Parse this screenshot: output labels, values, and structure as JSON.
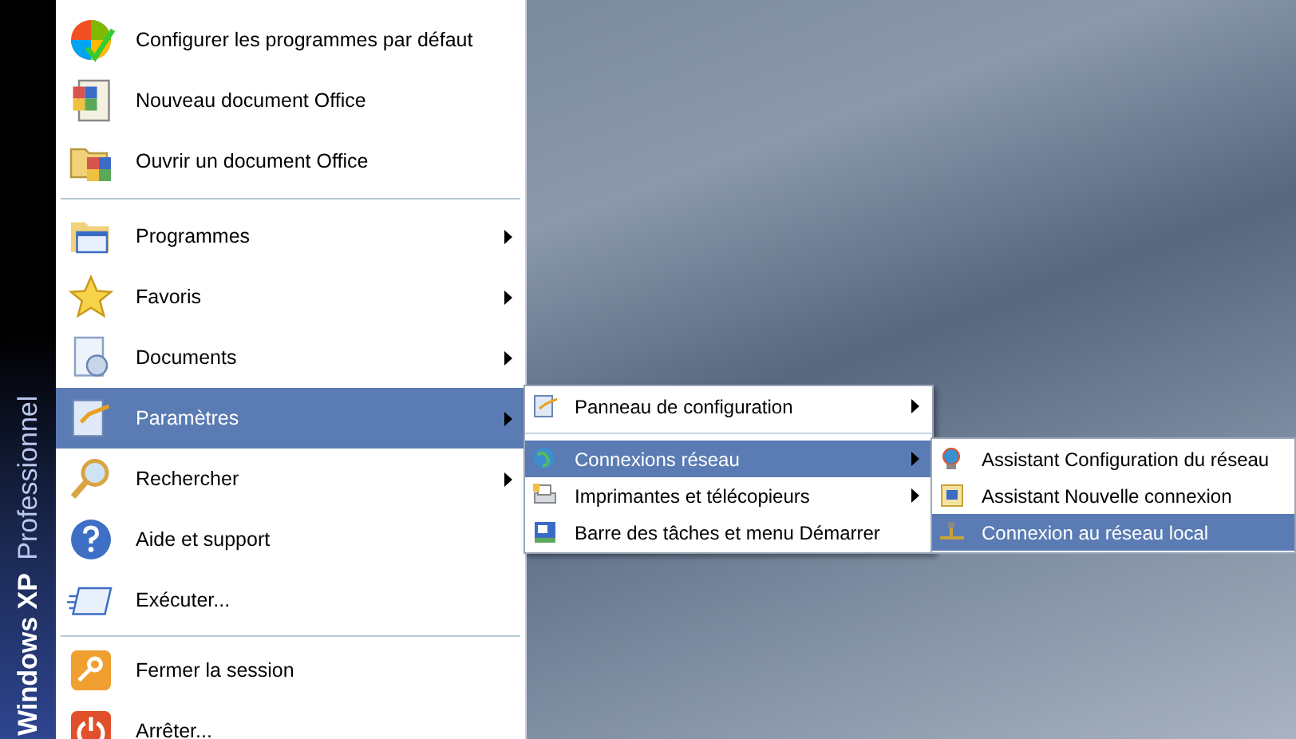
{
  "banner": {
    "brand": "Windows XP",
    "edition": "Professionnel"
  },
  "start_menu": {
    "pinned": [
      {
        "label": "Configurer les programmes par défaut"
      },
      {
        "label": "Nouveau document Office"
      },
      {
        "label": "Ouvrir un document Office"
      }
    ],
    "items": [
      {
        "label": "Programmes",
        "has_submenu": true,
        "selected": false
      },
      {
        "label": "Favoris",
        "has_submenu": true,
        "selected": false
      },
      {
        "label": "Documents",
        "has_submenu": true,
        "selected": false
      },
      {
        "label": "Paramètres",
        "has_submenu": true,
        "selected": true
      },
      {
        "label": "Rechercher",
        "has_submenu": true,
        "selected": false
      },
      {
        "label": "Aide et support",
        "has_submenu": false,
        "selected": false
      },
      {
        "label": "Exécuter...",
        "has_submenu": false,
        "selected": false
      }
    ],
    "session": [
      {
        "label": "Fermer la session"
      },
      {
        "label": "Arrêter..."
      }
    ]
  },
  "settings_submenu": {
    "items": [
      {
        "label": "Panneau de configuration",
        "has_submenu": true,
        "selected": false
      },
      {
        "label": "Connexions réseau",
        "has_submenu": true,
        "selected": true
      },
      {
        "label": "Imprimantes et télécopieurs",
        "has_submenu": true,
        "selected": false
      },
      {
        "label": "Barre des tâches et menu Démarrer",
        "has_submenu": false,
        "selected": false
      }
    ]
  },
  "network_submenu": {
    "items": [
      {
        "label": "Assistant Configuration du réseau",
        "selected": false
      },
      {
        "label": "Assistant Nouvelle connexion",
        "selected": false
      },
      {
        "label": "Connexion au réseau local",
        "selected": true
      }
    ]
  }
}
